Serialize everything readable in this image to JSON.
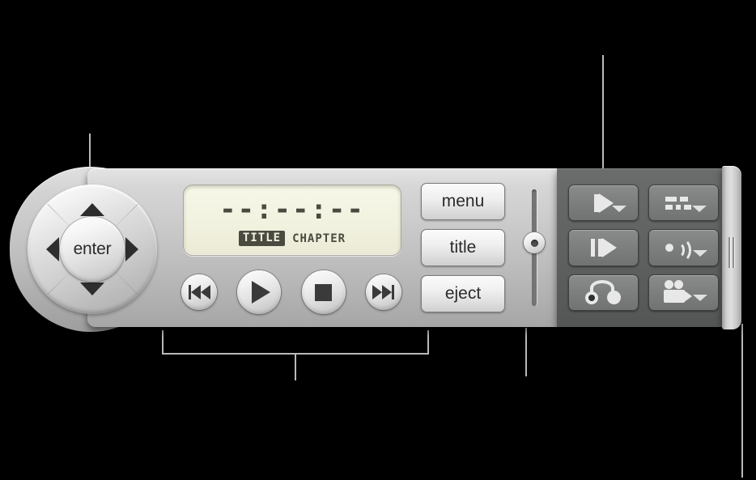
{
  "display": {
    "time": "--:--:--",
    "title_label": "TITLE",
    "chapter_label": "CHAPTER"
  },
  "dpad": {
    "enter_label": "enter",
    "up_icon": "triangle-up-icon",
    "down_icon": "triangle-down-icon",
    "left_icon": "triangle-left-icon",
    "right_icon": "triangle-right-icon"
  },
  "transport": {
    "previous_icon": "skip-previous-icon",
    "play_icon": "play-icon",
    "stop_icon": "stop-icon",
    "next_icon": "skip-next-icon"
  },
  "function_buttons": {
    "menu_label": "menu",
    "title_label": "title",
    "eject_label": "eject"
  },
  "volume": {
    "knob_icon": "slider-knob-icon",
    "track_icon": "slider-track-icon"
  },
  "dark_panel": {
    "buttons": [
      {
        "name": "step-forward-button",
        "icon": "step-forward-icon",
        "has_caret": true
      },
      {
        "name": "subtitles-button",
        "icon": "subtitles-icon",
        "has_caret": true
      },
      {
        "name": "slow-motion-button",
        "icon": "slow-motion-icon",
        "has_caret": false
      },
      {
        "name": "audio-track-button",
        "icon": "audio-waves-icon",
        "has_caret": true
      },
      {
        "name": "bookmarks-button",
        "icon": "bookmark-loop-icon",
        "has_caret": false
      },
      {
        "name": "camera-angle-button",
        "icon": "video-camera-icon",
        "has_caret": true
      }
    ]
  },
  "handle": {
    "grip_icon": "grip-lines-icon"
  },
  "colors": {
    "background": "#000000",
    "body_light": "#c6c6c6",
    "body_dark": "#5f6160",
    "lcd": "#f2f2e0",
    "lcd_text": "#4a4a40",
    "callout_line": "#b9b9b9",
    "icon_light": "#e8e8e8",
    "icon_dark": "#3a3a3a"
  }
}
